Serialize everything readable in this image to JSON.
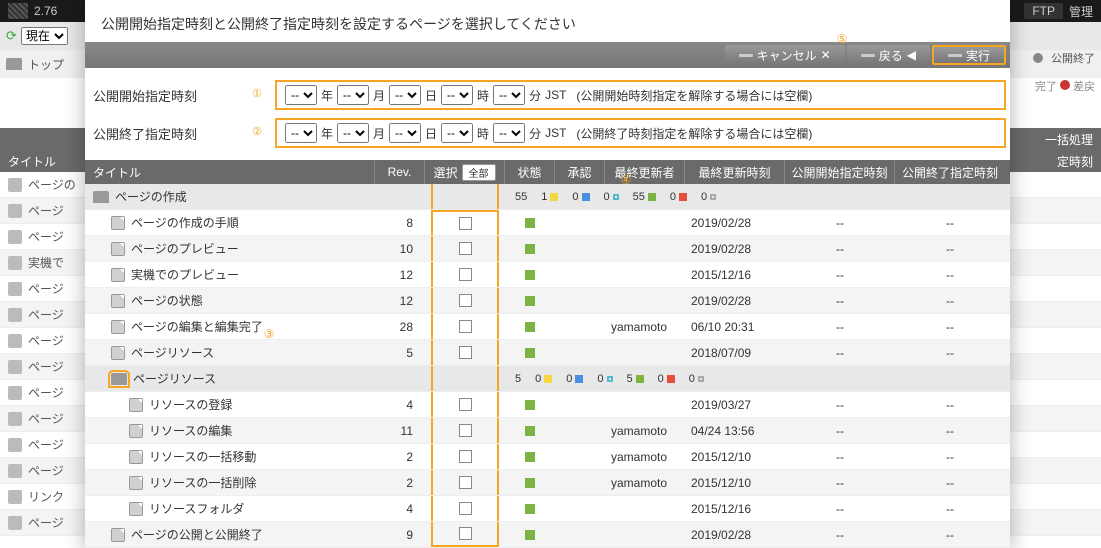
{
  "bg": {
    "version": "2.76",
    "ftp": "FTP",
    "admin": "管理",
    "now": "現在",
    "top": "トップ",
    "titlehdr": "タイトル",
    "right1a": "公開終了",
    "right2a": "完了",
    "right2b": "差戻",
    "batch": "一括処理",
    "timehdr": "定時刻",
    "rows": [
      "ページの",
      "ページ",
      "ページ",
      "実機で",
      "ページ",
      "ページ",
      "ページ",
      "ページ",
      "ページ",
      "ページ",
      "ページ",
      "ページ",
      "リンク",
      "ページ"
    ]
  },
  "modal": {
    "title": "公開開始指定時刻と公開終了指定時刻を設定するページを選択してください",
    "cancel": "キャンセル",
    "back": "戻る",
    "exec": "実行",
    "start_label": "公開開始指定時刻",
    "end_label": "公開終了指定時刻",
    "sel_placeholder": "--",
    "y": "年",
    "m": "月",
    "d": "日",
    "h": "時",
    "min": "分",
    "tz": "JST",
    "start_note": "(公開開始時刻指定を解除する場合には空欄)",
    "end_note": "(公開終了時刻指定を解除する場合には空欄)"
  },
  "callouts": {
    "c1": "①",
    "c2": "②",
    "c3": "③",
    "c4": "④",
    "c5": "⑤"
  },
  "headers": {
    "title": "タイトル",
    "rev": "Rev.",
    "select": "選択",
    "all": "全部",
    "state": "状態",
    "approve": "承認",
    "updater": "最終更新者",
    "updated": "最終更新時刻",
    "start": "公開開始指定時刻",
    "end": "公開終了指定時刻"
  },
  "folder1": {
    "title": "ページの作成",
    "stats": [
      {
        "n": "55"
      },
      {
        "n": "1",
        "c": "yellow"
      },
      {
        "n": "0",
        "c": "blue"
      },
      {
        "n": "0",
        "c": "teal"
      },
      {
        "n": "55",
        "c": "green"
      },
      {
        "n": "0",
        "c": "red"
      },
      {
        "n": "0",
        "c": "gray"
      }
    ]
  },
  "rows": [
    {
      "title": "ページの作成の手順",
      "rev": "8",
      "indent": 1,
      "user": "",
      "upd": "2019/02/28",
      "start": "--",
      "end": "--",
      "alt": false,
      "selTop": true
    },
    {
      "title": "ページのプレビュー",
      "rev": "10",
      "indent": 1,
      "user": "",
      "upd": "2019/02/28",
      "start": "--",
      "end": "--",
      "alt": true
    },
    {
      "title": "実機でのプレビュー",
      "rev": "12",
      "indent": 1,
      "user": "",
      "upd": "2015/12/16",
      "start": "--",
      "end": "--",
      "alt": false
    },
    {
      "title": "ページの状態",
      "rev": "12",
      "indent": 1,
      "user": "",
      "upd": "2019/02/28",
      "start": "--",
      "end": "--",
      "alt": true
    },
    {
      "title": "ページの編集と編集完了",
      "rev": "28",
      "indent": 1,
      "user": "yamamoto",
      "upd": "06/10 20:31",
      "start": "--",
      "end": "--",
      "alt": false
    },
    {
      "title": "ページリソース",
      "rev": "5",
      "indent": 1,
      "user": "",
      "upd": "2018/07/09",
      "start": "--",
      "end": "--",
      "alt": true
    }
  ],
  "folder2": {
    "title": "ページリソース",
    "stats": [
      {
        "n": "5"
      },
      {
        "n": "0",
        "c": "yellow"
      },
      {
        "n": "0",
        "c": "blue"
      },
      {
        "n": "0",
        "c": "teal"
      },
      {
        "n": "5",
        "c": "green"
      },
      {
        "n": "0",
        "c": "red"
      },
      {
        "n": "0",
        "c": "gray"
      }
    ]
  },
  "rows2": [
    {
      "title": "リソースの登録",
      "rev": "4",
      "indent": 2,
      "user": "",
      "upd": "2019/03/27",
      "start": "--",
      "end": "--",
      "alt": false
    },
    {
      "title": "リソースの編集",
      "rev": "11",
      "indent": 2,
      "user": "yamamoto",
      "upd": "04/24 13:56",
      "start": "--",
      "end": "--",
      "alt": true
    },
    {
      "title": "リソースの一括移動",
      "rev": "2",
      "indent": 2,
      "user": "yamamoto",
      "upd": "2015/12/10",
      "start": "--",
      "end": "--",
      "alt": false
    },
    {
      "title": "リソースの一括削除",
      "rev": "2",
      "indent": 2,
      "user": "yamamoto",
      "upd": "2015/12/10",
      "start": "--",
      "end": "--",
      "alt": true
    },
    {
      "title": "リソースフォルダ",
      "rev": "4",
      "indent": 2,
      "user": "",
      "upd": "2015/12/16",
      "start": "--",
      "end": "--",
      "alt": false
    },
    {
      "title": "ページの公開と公開終了",
      "rev": "9",
      "indent": 1,
      "user": "",
      "upd": "2019/02/28",
      "start": "--",
      "end": "--",
      "alt": true,
      "selBottom": true
    }
  ]
}
